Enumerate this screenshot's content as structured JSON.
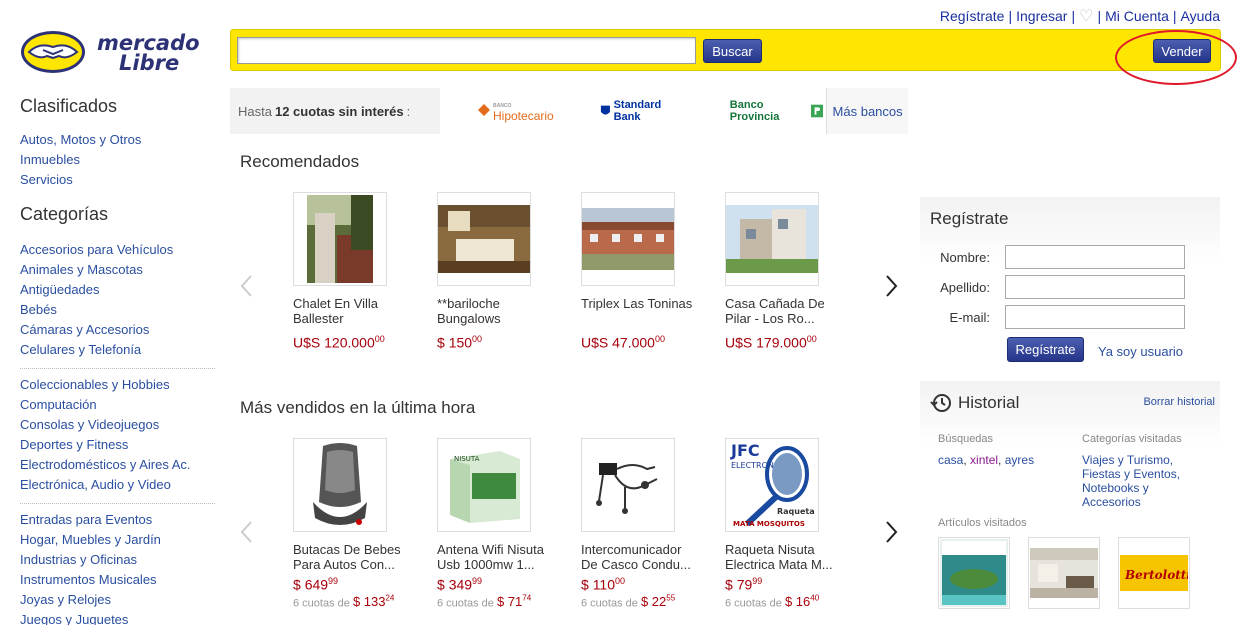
{
  "top_links": {
    "register": "Regístrate",
    "login": "Ingresar",
    "account": "Mi Cuenta",
    "help": "Ayuda"
  },
  "logo": {
    "line1": "mercado",
    "line2": "Libre"
  },
  "search": {
    "value": "",
    "placeholder": "",
    "button": "Buscar",
    "sell_button": "Vender"
  },
  "colors": {
    "brand_yellow": "#ffe600",
    "button_blue": "#2b3b92",
    "price_red": "#a8000a",
    "annotation_red": "#e0182a"
  },
  "sidebar": {
    "clasificados_title": "Clasificados",
    "clasificados": [
      "Autos, Motos y Otros",
      "Inmuebles",
      "Servicios"
    ],
    "categorias_title": "Categorías",
    "group1": [
      "Accesorios para Vehículos",
      "Animales y Mascotas",
      "Antigüedades",
      "Bebés",
      "Cámaras y Accesorios",
      "Celulares y Telefonía"
    ],
    "group2": [
      "Coleccionables y Hobbies",
      "Computación",
      "Consolas y Videojuegos",
      "Deportes y Fitness",
      "Electrodomésticos y Aires Ac.",
      "Electrónica, Audio y Video"
    ],
    "group3": [
      "Entradas para Eventos",
      "Hogar, Muebles y Jardín",
      "Industrias y Oficinas",
      "Instrumentos Musicales",
      "Joyas y Relojes",
      "Juegos y Juguetes"
    ]
  },
  "cuotas": {
    "prefix": "Hasta",
    "bold": "12 cuotas sin interés",
    "suffix": ":",
    "banks": [
      "Hipotecario",
      "Standard Bank",
      "Banco Provincia"
    ],
    "bank_small": "BANCO",
    "more": "Más bancos"
  },
  "recomendados": {
    "title": "Recomendados",
    "items": [
      {
        "name": "Chalet En Villa Ballester",
        "cur": "U$S ",
        "int": "120.000",
        "dec": "00"
      },
      {
        "name": "**bariloche Bungalows",
        "cur": "$ ",
        "int": "150",
        "dec": "00"
      },
      {
        "name": "Triplex Las Toninas",
        "cur": "U$S ",
        "int": "47.000",
        "dec": "00"
      },
      {
        "name": "Casa Cañada De Pilar - Los Ro...",
        "cur": "U$S ",
        "int": "179.000",
        "dec": "00"
      }
    ]
  },
  "vendidos": {
    "title": "Más vendidos en la última hora",
    "items": [
      {
        "name": "Butacas De Bebes Para Autos Con...",
        "cur": "$ ",
        "int": "649",
        "dec": "99",
        "cuota_prefix": "6 cuotas de ",
        "cuota_cur": "$ ",
        "cuota_int": "133",
        "cuota_dec": "24"
      },
      {
        "name": "Antena Wifi Nisuta Usb 1000mw 1...",
        "cur": "$ ",
        "int": "349",
        "dec": "99",
        "cuota_prefix": "6 cuotas de ",
        "cuota_cur": "$ ",
        "cuota_int": "71",
        "cuota_dec": "74"
      },
      {
        "name": "Intercomunicador De Casco Condu...",
        "cur": "$ ",
        "int": "110",
        "dec": "00",
        "cuota_prefix": "6 cuotas de ",
        "cuota_cur": "$ ",
        "cuota_int": "22",
        "cuota_dec": "55"
      },
      {
        "name": "Raqueta Nisuta Electrica Mata M...",
        "cur": "$ ",
        "int": "79",
        "dec": "99",
        "cuota_prefix": "6 cuotas de ",
        "cuota_cur": "$ ",
        "cuota_int": "16",
        "cuota_dec": "40"
      }
    ],
    "thumb_texts": {
      "nisuta": "NISUTA",
      "jfc": "JFC",
      "electronica": "ELECTRONICA",
      "raqueta": "Raqueta",
      "mata": "MATA MOSQUITOS"
    }
  },
  "registro": {
    "title": "Regístrate",
    "nombre_label": "Nombre:",
    "apellido_label": "Apellido:",
    "email_label": "E-mail:",
    "submit": "Regístrate",
    "already": "Ya soy usuario"
  },
  "historial": {
    "title": "Historial",
    "clear": "Borrar historial",
    "busquedas_title": "Búsquedas",
    "busquedas": [
      "casa",
      "xintel",
      "ayres"
    ],
    "categorias_title": "Categorías visitadas",
    "categorias": [
      "Viajes y Turismo,",
      "Fiestas y Eventos,",
      "Notebooks y Accesorios"
    ],
    "articulos_title": "Artículos visitados",
    "bertolotti": "Bertolotti"
  }
}
